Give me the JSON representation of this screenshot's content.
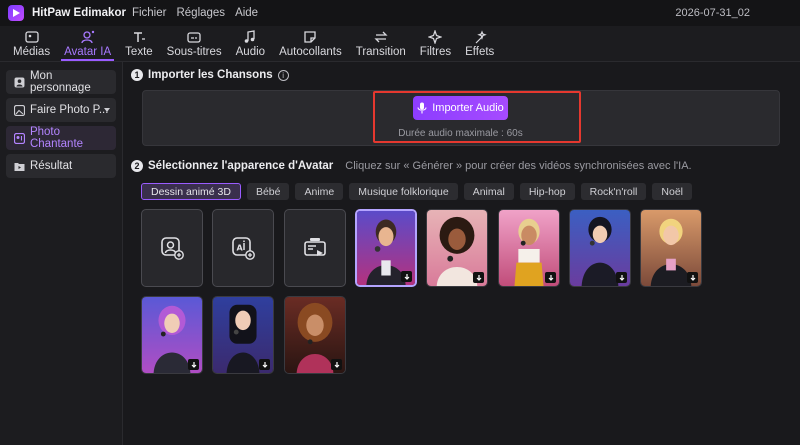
{
  "app": {
    "name": "HitPaw Edimakor",
    "date": "2026-07-31_02"
  },
  "menu": [
    "Fichier",
    "Réglages",
    "Aide"
  ],
  "toolbar": [
    {
      "label": "Médias",
      "icon": "media-icon",
      "active": false
    },
    {
      "label": "Avatar IA",
      "icon": "avatar-ai-icon",
      "active": true
    },
    {
      "label": "Texte",
      "icon": "text-icon",
      "active": false
    },
    {
      "label": "Sous-titres",
      "icon": "subtitles-icon",
      "active": false
    },
    {
      "label": "Audio",
      "icon": "audio-icon",
      "active": false
    },
    {
      "label": "Autocollants",
      "icon": "stickers-icon",
      "active": false
    },
    {
      "label": "Transition",
      "icon": "transition-icon",
      "active": false
    },
    {
      "label": "Filtres",
      "icon": "filters-icon",
      "active": false
    },
    {
      "label": "Effets",
      "icon": "effects-icon",
      "active": false
    }
  ],
  "sidebar": [
    {
      "label": "Mon personnage",
      "icon": "person-icon",
      "active": false
    },
    {
      "label": "Faire Photo P...",
      "icon": "photo-icon",
      "active": false,
      "dropdown": true
    },
    {
      "label": "Photo Chantante",
      "icon": "singing-photo-icon",
      "active": true
    },
    {
      "label": "Résultat",
      "icon": "folder-icon",
      "active": false
    }
  ],
  "step1": {
    "number": "1",
    "title": "Importer les Chansons",
    "info": "i"
  },
  "upload": {
    "button": "Importer Audio",
    "duration": "Durée audio maximale : 60s"
  },
  "step2": {
    "number": "2",
    "title": "Sélectionnez l'apparence d'Avatar",
    "description": "Cliquez sur « Générer » pour créer des vidéos synchronisées avec l'IA."
  },
  "filters": [
    "Dessin animé 3D",
    "Bébé",
    "Anime",
    "Musique folklorique",
    "Animal",
    "Hip-hop",
    "Rock'n'roll",
    "Noël"
  ],
  "colors": {
    "accent": "#9a5cff",
    "highlight": "#e5382f",
    "background": "#19191c"
  }
}
